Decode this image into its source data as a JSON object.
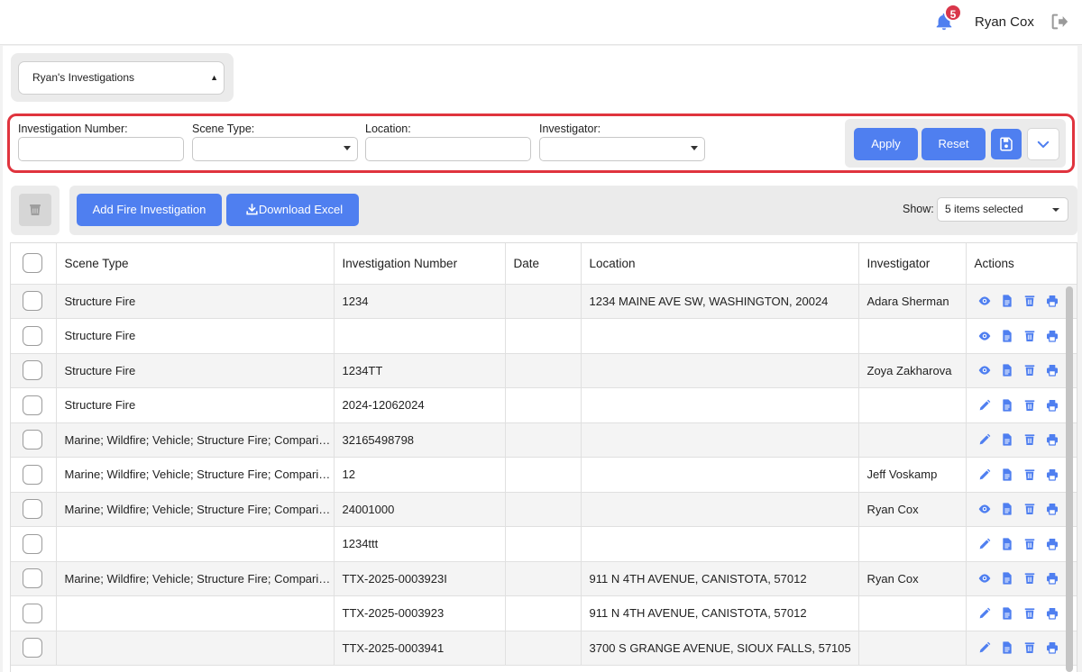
{
  "header": {
    "notification_count": "5",
    "user_name": "Ryan Cox"
  },
  "saved_view": {
    "selected": "Ryan's Investigations"
  },
  "filters": {
    "investigation_number_label": "Investigation Number:",
    "scene_type_label": "Scene Type:",
    "location_label": "Location:",
    "investigator_label": "Investigator:",
    "investigation_number_value": "",
    "scene_type_value": "",
    "location_value": "",
    "investigator_value": "",
    "apply_label": "Apply",
    "reset_label": "Reset"
  },
  "toolbar": {
    "add_label": "Add Fire Investigation",
    "download_label": "Download Excel",
    "show_label": "Show:",
    "show_value": "5 items selected"
  },
  "table": {
    "columns": [
      "Scene Type",
      "Investigation Number",
      "Date",
      "Location",
      "Investigator",
      "Actions"
    ],
    "rows": [
      {
        "scene": "Structure Fire",
        "number": "1234",
        "date": "",
        "location": "1234 MAINE AVE SW, WASHINGTON, 20024",
        "investigator": "Adara Sherman",
        "first_action": "view"
      },
      {
        "scene": "Structure Fire",
        "number": "",
        "date": "",
        "location": "",
        "investigator": "",
        "first_action": "view"
      },
      {
        "scene": "Structure Fire",
        "number": "1234TT",
        "date": "",
        "location": "",
        "investigator": "Zoya Zakharova",
        "first_action": "view"
      },
      {
        "scene": "Structure Fire",
        "number": "2024-12062024",
        "date": "",
        "location": "",
        "investigator": "",
        "first_action": "edit"
      },
      {
        "scene": "Marine; Wildfire; Vehicle; Structure Fire; Comparison",
        "number": "32165498798",
        "date": "",
        "location": "",
        "investigator": "",
        "first_action": "edit"
      },
      {
        "scene": "Marine; Wildfire; Vehicle; Structure Fire; Comparison",
        "number": "12",
        "date": "",
        "location": "",
        "investigator": "Jeff Voskamp",
        "first_action": "edit"
      },
      {
        "scene": "Marine; Wildfire; Vehicle; Structure Fire; Comparison",
        "number": "24001000",
        "date": "",
        "location": "",
        "investigator": "Ryan Cox",
        "first_action": "view"
      },
      {
        "scene": "",
        "number": "1234ttt",
        "date": "",
        "location": "",
        "investigator": "",
        "first_action": "edit"
      },
      {
        "scene": "Marine; Wildfire; Vehicle; Structure Fire; Comparison",
        "number": "TTX-2025-0003923I",
        "date": "",
        "location": "911 N 4TH AVENUE, CANISTOTA, 57012",
        "investigator": "Ryan Cox",
        "first_action": "view"
      },
      {
        "scene": "",
        "number": "TTX-2025-0003923",
        "date": "",
        "location": "911 N 4TH AVENUE, CANISTOTA, 57012",
        "investigator": "",
        "first_action": "edit"
      },
      {
        "scene": "",
        "number": "TTX-2025-0003941",
        "date": "",
        "location": "3700 S GRANGE AVENUE, SIOUX FALLS, 57105",
        "investigator": "",
        "first_action": "edit"
      }
    ]
  },
  "colors": {
    "accent": "#4f7ff0",
    "badge": "#d9364a",
    "highlight": "#e0343e"
  }
}
